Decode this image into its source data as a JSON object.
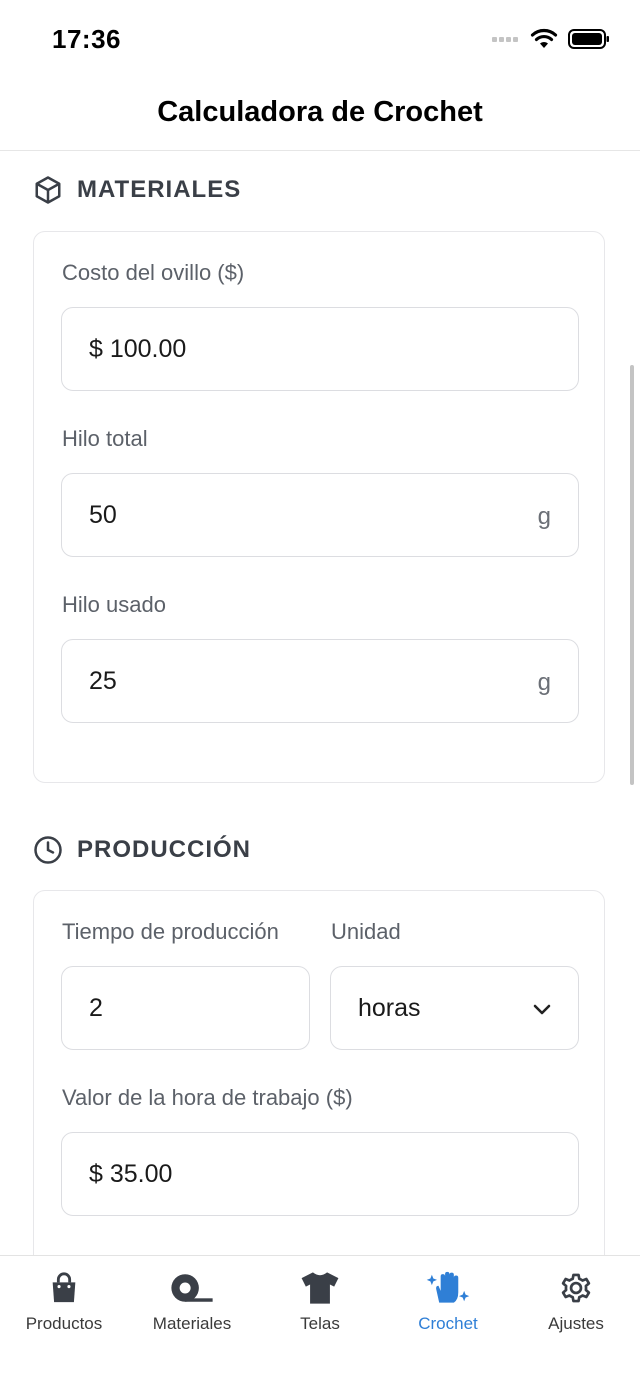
{
  "status": {
    "time": "17:36"
  },
  "header": {
    "title": "Calculadora de Crochet"
  },
  "materials": {
    "section_title": "MATERIALES",
    "skein_cost": {
      "label": "Costo del ovillo ($)",
      "value": "$ 100.00"
    },
    "total_yarn": {
      "label": "Hilo total",
      "value": "50",
      "unit": "g"
    },
    "used_yarn": {
      "label": "Hilo usado",
      "value": "25",
      "unit": "g"
    }
  },
  "production": {
    "section_title": "PRODUCCIÓN",
    "production_time": {
      "label": "Tiempo de producción",
      "value": "2"
    },
    "unit": {
      "label": "Unidad",
      "value": "horas"
    },
    "hourly_rate": {
      "label": "Valor de la hora de trabajo ($)",
      "value": "$ 35.00"
    }
  },
  "tabs": [
    {
      "label": "Productos",
      "icon": "shopping-bag-icon",
      "active": false
    },
    {
      "label": "Materiales",
      "icon": "tape-roll-icon",
      "active": false
    },
    {
      "label": "Telas",
      "icon": "t-shirt-icon",
      "active": false
    },
    {
      "label": "Crochet",
      "icon": "hand-sparkles-icon",
      "active": true
    },
    {
      "label": "Ajustes",
      "icon": "gear-icon",
      "active": false
    }
  ],
  "colors": {
    "accent": "#2f7fd6",
    "icon_dark": "#3a3f47"
  }
}
